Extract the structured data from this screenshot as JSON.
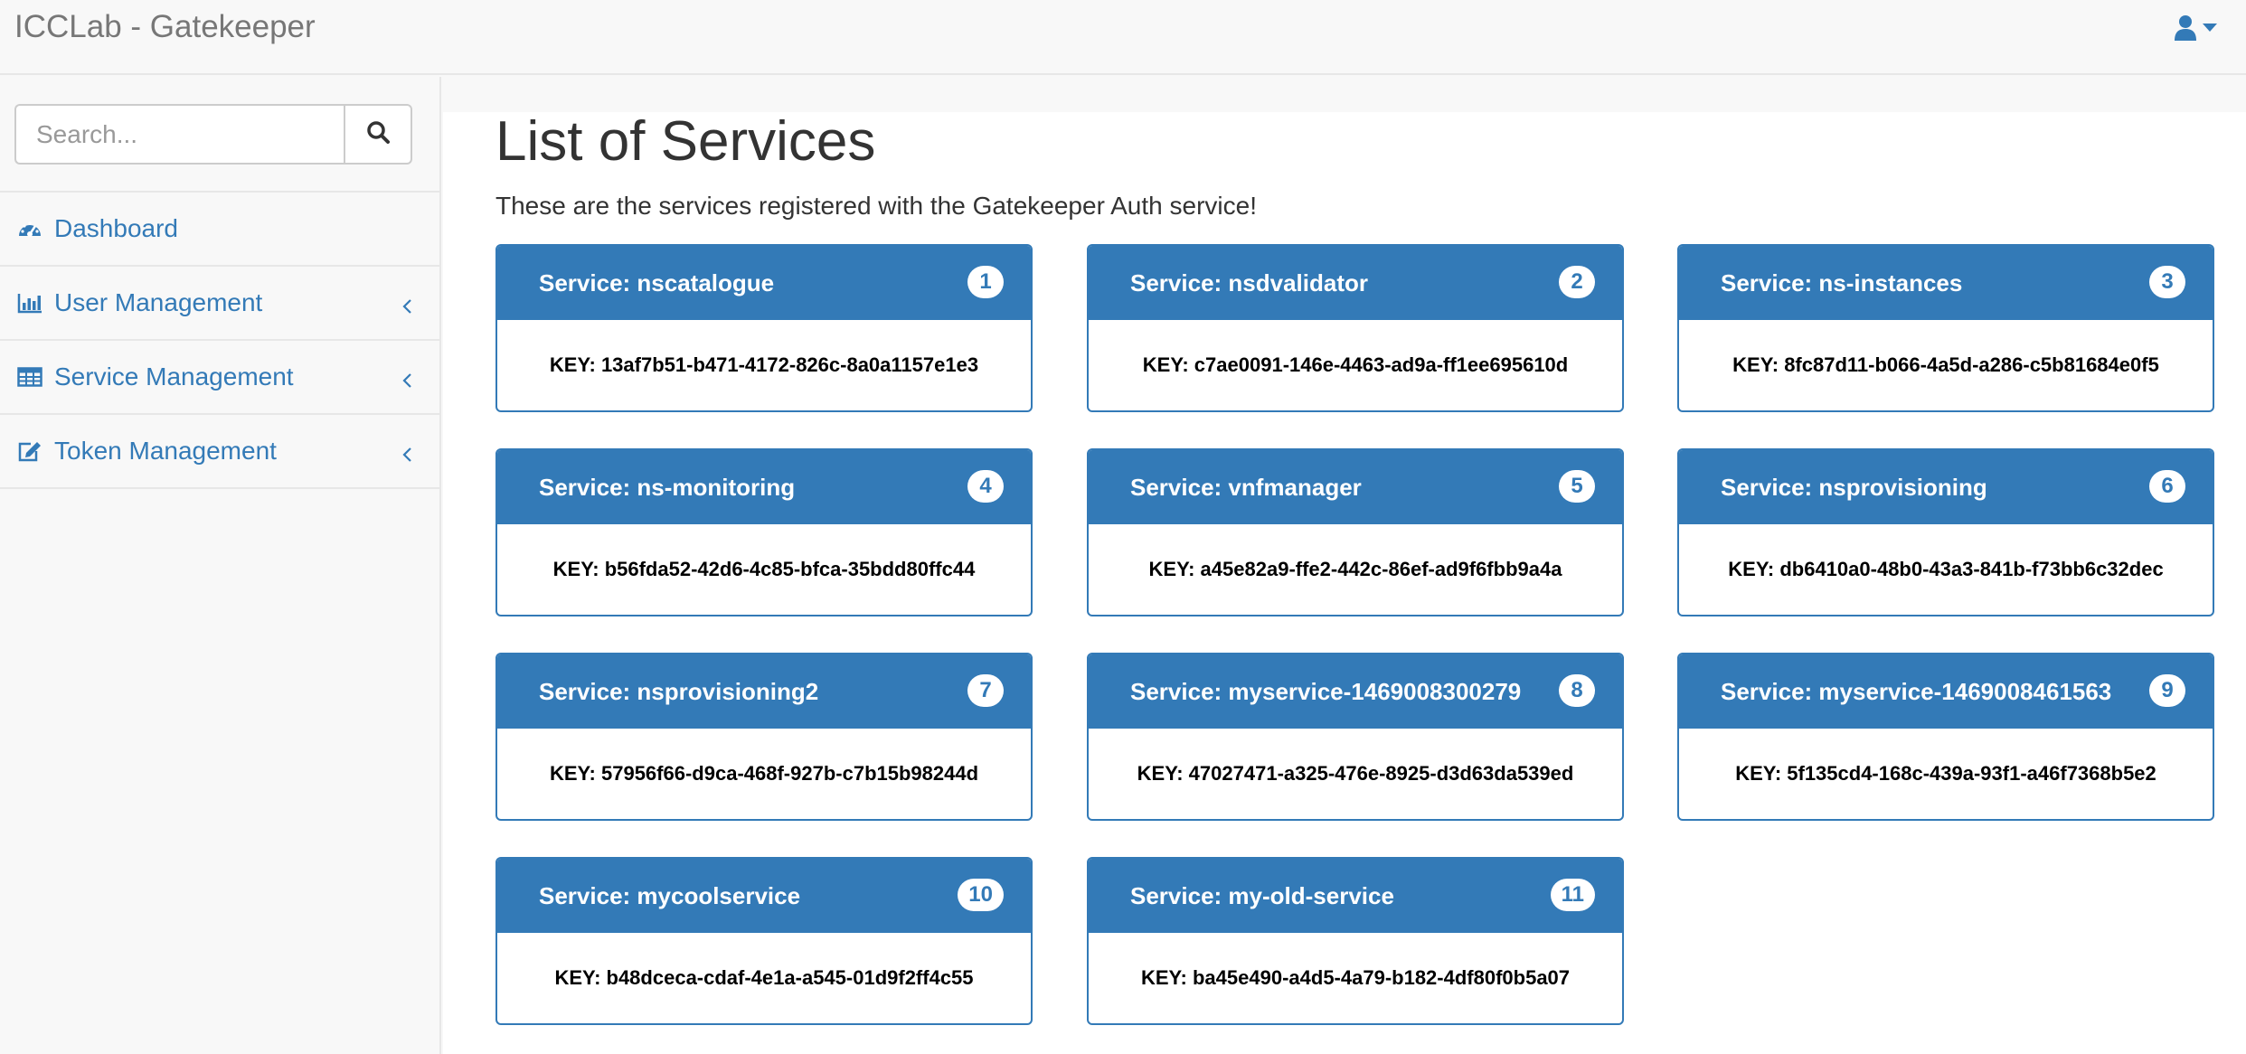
{
  "navbar": {
    "brand": "ICCLab - Gatekeeper"
  },
  "search": {
    "placeholder": "Search..."
  },
  "sidebar": {
    "items": [
      {
        "label": "Dashboard",
        "icon": "dashboard-icon"
      },
      {
        "label": "User Management",
        "icon": "bar-chart-icon"
      },
      {
        "label": "Service Management",
        "icon": "table-icon"
      },
      {
        "label": "Token Management",
        "icon": "edit-icon"
      }
    ]
  },
  "main": {
    "title": "List of Services",
    "description": "These are the services registered with the Gatekeeper Auth service!"
  },
  "services": [
    {
      "title": "Service: nscatalogue",
      "badge": "1",
      "key": "KEY: 13af7b51-b471-4172-826c-8a0a1157e1e3"
    },
    {
      "title": "Service: nsdvalidator",
      "badge": "2",
      "key": "KEY: c7ae0091-146e-4463-ad9a-ff1ee695610d"
    },
    {
      "title": "Service: ns-instances",
      "badge": "3",
      "key": "KEY: 8fc87d11-b066-4a5d-a286-c5b81684e0f5"
    },
    {
      "title": "Service: ns-monitoring",
      "badge": "4",
      "key": "KEY: b56fda52-42d6-4c85-bfca-35bdd80ffc44"
    },
    {
      "title": "Service: vnfmanager",
      "badge": "5",
      "key": "KEY: a45e82a9-ffe2-442c-86ef-ad9f6fbb9a4a"
    },
    {
      "title": "Service: nsprovisioning",
      "badge": "6",
      "key": "KEY: db6410a0-48b0-43a3-841b-f73bb6c32dec"
    },
    {
      "title": "Service: nsprovisioning2",
      "badge": "7",
      "key": "KEY: 57956f66-d9ca-468f-927b-c7b15b98244d"
    },
    {
      "title": "Service: myservice-1469008300279",
      "badge": "8",
      "key": "KEY: 47027471-a325-476e-8925-d3d63da539ed"
    },
    {
      "title": "Service: myservice-1469008461563",
      "badge": "9",
      "key": "KEY: 5f135cd4-168c-439a-93f1-a46f7368b5e2"
    },
    {
      "title": "Service: mycoolservice",
      "badge": "10",
      "key": "KEY: b48dceca-cdaf-4e1a-a545-01d9f2ff4c55"
    },
    {
      "title": "Service: my-old-service",
      "badge": "11",
      "key": "KEY: ba45e490-a4d5-4a79-b182-4df80f0b5a07"
    }
  ],
  "colors": {
    "primary": "#337ab7",
    "navbar_bg": "#f8f8f8",
    "brand_text": "#777777"
  }
}
